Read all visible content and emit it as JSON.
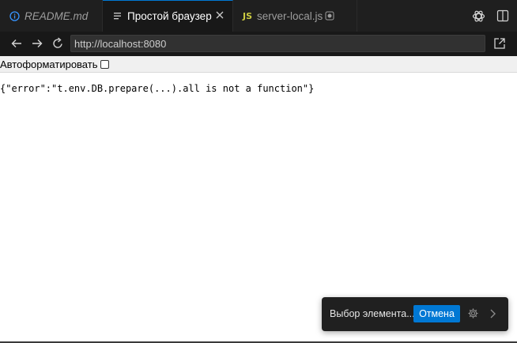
{
  "tabs": [
    {
      "label": "README.md",
      "icon": "info-icon"
    },
    {
      "label": "Простой браузер",
      "icon": "preview-icon",
      "active": true
    },
    {
      "label": "server-local.js",
      "icon": "js-file-icon",
      "badge": "JS"
    }
  ],
  "tab_actions": [
    "copilot-icon",
    "split-editor-icon"
  ],
  "nav": {
    "url": "http://localhost:8080",
    "icons": [
      "arrow-left-icon",
      "arrow-right-icon",
      "reload-icon",
      "open-external-icon"
    ]
  },
  "page": {
    "autoformat_label": "Автоформатировать",
    "autoformat_checked": false,
    "body_text": "{\"error\":\"t.env.DB.prepare(...).all is not a function\"}"
  },
  "picker": {
    "label": "Выбор элемента...",
    "cancel_label": "Отмена"
  },
  "colors": {
    "accent": "#0078d4",
    "tabbar_bg": "#1f1f1f",
    "js_badge": "#cbcb41"
  }
}
